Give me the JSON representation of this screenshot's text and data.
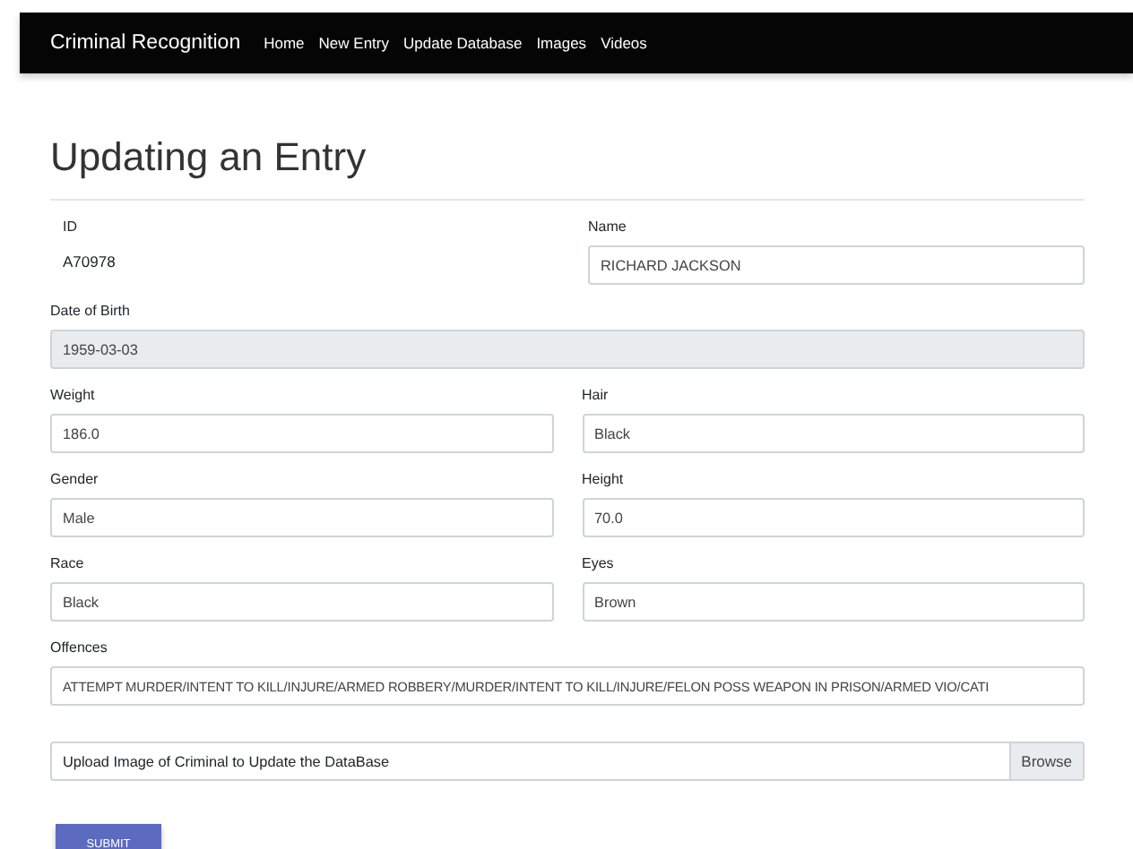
{
  "navbar": {
    "brand": "Criminal Recognition",
    "links": [
      {
        "label": "Home"
      },
      {
        "label": "New Entry"
      },
      {
        "label": "Update Database"
      },
      {
        "label": "Images"
      },
      {
        "label": "Videos"
      }
    ]
  },
  "heading": "Updating an Entry",
  "rows": [
    [
      {
        "label": "ID",
        "value": "A70978",
        "kind": "static"
      },
      {
        "label": "Name",
        "value": "RICHARD JACKSON",
        "kind": "input"
      }
    ],
    [
      {
        "label": "Date of Birth",
        "value": "1959-03-03",
        "kind": "disabled"
      }
    ],
    [
      {
        "label": "Weight",
        "value": "186.0",
        "kind": "input"
      },
      {
        "label": "Hair",
        "value": "Black",
        "kind": "input"
      }
    ],
    [
      {
        "label": "Gender",
        "value": "Male",
        "kind": "input"
      },
      {
        "label": "Height",
        "value": "70.0",
        "kind": "input"
      }
    ],
    [
      {
        "label": "Race",
        "value": "Black",
        "kind": "input"
      },
      {
        "label": "Eyes",
        "value": "Brown",
        "kind": "input"
      }
    ],
    [
      {
        "label": "Offences",
        "value": "ATTEMPT MURDER/INTENT TO KILL/INJURE/ARMED ROBBERY/MURDER/INTENT TO KILL/INJURE/FELON POSS WEAPON IN PRISON/ARMED VIO/CATI",
        "kind": "long"
      }
    ]
  ],
  "upload": {
    "label": "Upload Image of Criminal to Update the DataBase",
    "button": "Browse"
  },
  "submit": "SUBMIT"
}
